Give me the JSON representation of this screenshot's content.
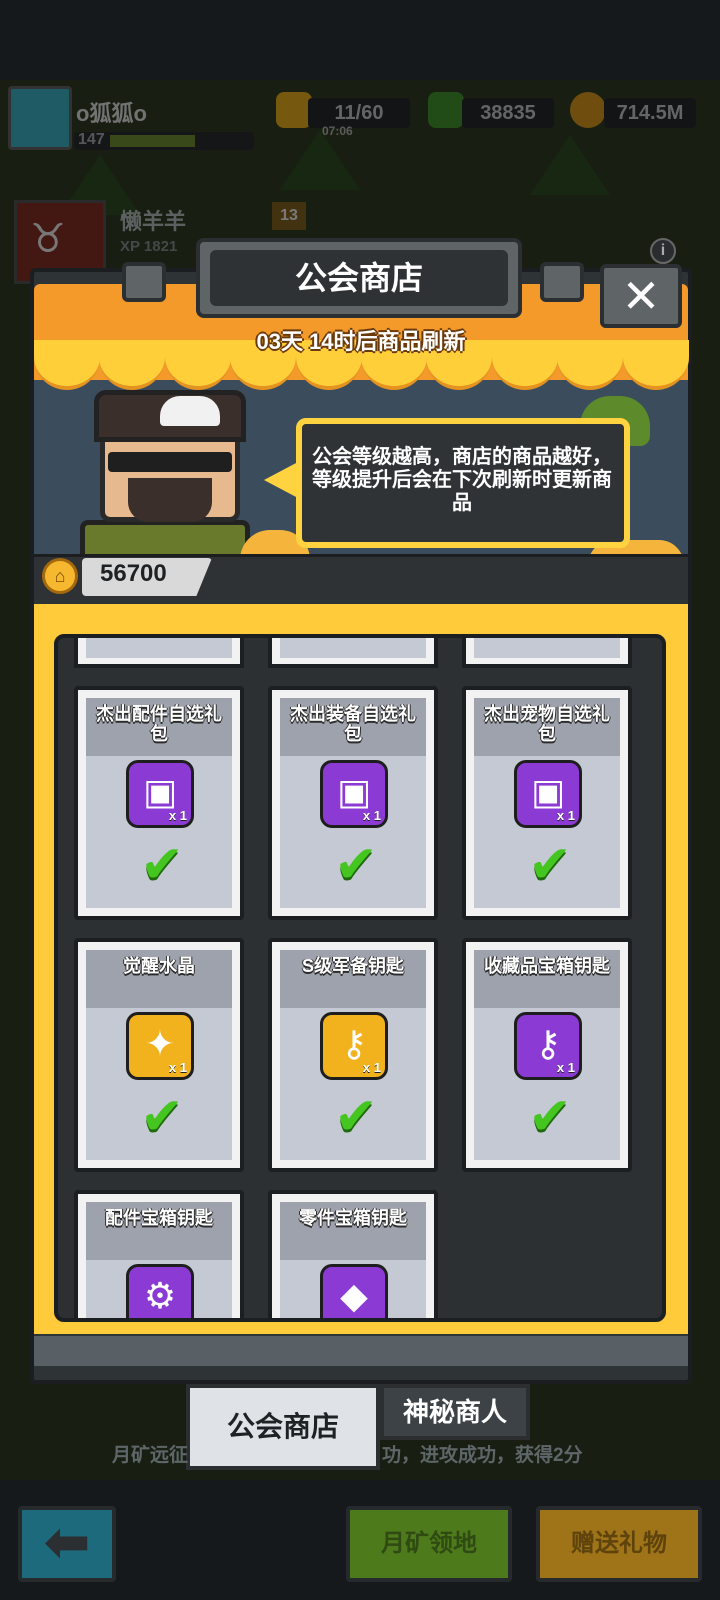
{
  "hud": {
    "player_name": "o狐狐o",
    "player_level": "147",
    "stamina": "11/60",
    "stamina_timer": "07:06",
    "gems": "38835",
    "gold": "714.5M"
  },
  "guild": {
    "name": "懒羊羊",
    "level": "13",
    "xp_label": "XP",
    "xp_value": "1821"
  },
  "shop": {
    "title": "公会商店",
    "close_label": "✕",
    "info_label": "i",
    "refresh_text": "03天 14时后商品刷新",
    "merchant_speech": "公会等级越高，商店的商品越好，等级提升后会在下次刷新时更新商品",
    "currency_value": "56700",
    "currency_icon": "guild-coin-icon"
  },
  "items": [
    {
      "name": "杰出配件自选礼包",
      "icon": "purple-chest-icon",
      "color": "#8b3bd4",
      "qty": "x 1",
      "purchased": true
    },
    {
      "name": "杰出装备自选礼包",
      "icon": "purple-chest-icon",
      "color": "#8b3bd4",
      "qty": "x 1",
      "purchased": true
    },
    {
      "name": "杰出宠物自选礼包",
      "icon": "purple-chest-icon",
      "color": "#8b3bd4",
      "qty": "x 1",
      "purchased": true
    },
    {
      "name": "觉醒水晶",
      "icon": "star-crystal-icon",
      "color": "#f1b21e",
      "qty": "x 1",
      "purchased": true
    },
    {
      "name": "S级军备钥匙",
      "icon": "key-icon",
      "color": "#f1b21e",
      "qty": "x 1",
      "purchased": true
    },
    {
      "name": "收藏品宝箱钥匙",
      "icon": "gold-key-icon",
      "color": "#8b3bd4",
      "qty": "x 1",
      "purchased": true
    },
    {
      "name": "配件宝箱钥匙",
      "icon": "gear-key-icon",
      "color": "#8b3bd4",
      "qty": "",
      "purchased": false
    },
    {
      "name": "零件宝箱钥匙",
      "icon": "gem-key-icon",
      "color": "#8b3bd4",
      "qty": "",
      "purchased": false
    }
  ],
  "tabs": {
    "active": "公会商店",
    "inactive": "神秘商人"
  },
  "ticker": {
    "left": "月矿远征",
    "right": "功，进攻成功，获得2分"
  },
  "bottom": {
    "back_label": "⬅",
    "territory_label": "月矿领地",
    "gift_label": "赠送礼物"
  }
}
